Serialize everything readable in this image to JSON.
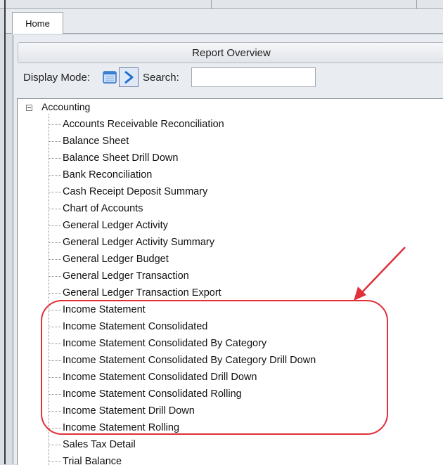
{
  "tabs": [
    {
      "label": "Home"
    }
  ],
  "panel": {
    "title": "Report Overview"
  },
  "toolbar": {
    "display_mode_label": "Display Mode:",
    "search_label": "Search:",
    "search_value": "",
    "modes": [
      {
        "icon": "calendar-icon",
        "selected": false
      },
      {
        "icon": "chevron-right-icon",
        "selected": true
      }
    ]
  },
  "tree": {
    "root": {
      "label": "Accounting",
      "expanded": true
    },
    "items": [
      "Accounts Receivable Reconciliation",
      "Balance Sheet",
      "Balance Sheet Drill Down",
      "Bank Reconciliation",
      "Cash Receipt Deposit Summary",
      "Chart of Accounts",
      "General Ledger Activity",
      "General Ledger Activity Summary",
      "General Ledger Budget",
      "General Ledger Transaction",
      "General Ledger Transaction Export",
      "Income Statement",
      "Income Statement Consolidated",
      "Income Statement Consolidated By Category",
      "Income Statement Consolidated By Category Drill Down",
      "Income Statement Consolidated Drill Down",
      "Income Statement Consolidated Rolling",
      "Income Statement Drill Down",
      "Income Statement Rolling",
      "Sales Tax Detail",
      "Trial Balance"
    ]
  },
  "annotation": {
    "color": "#e0303a"
  }
}
